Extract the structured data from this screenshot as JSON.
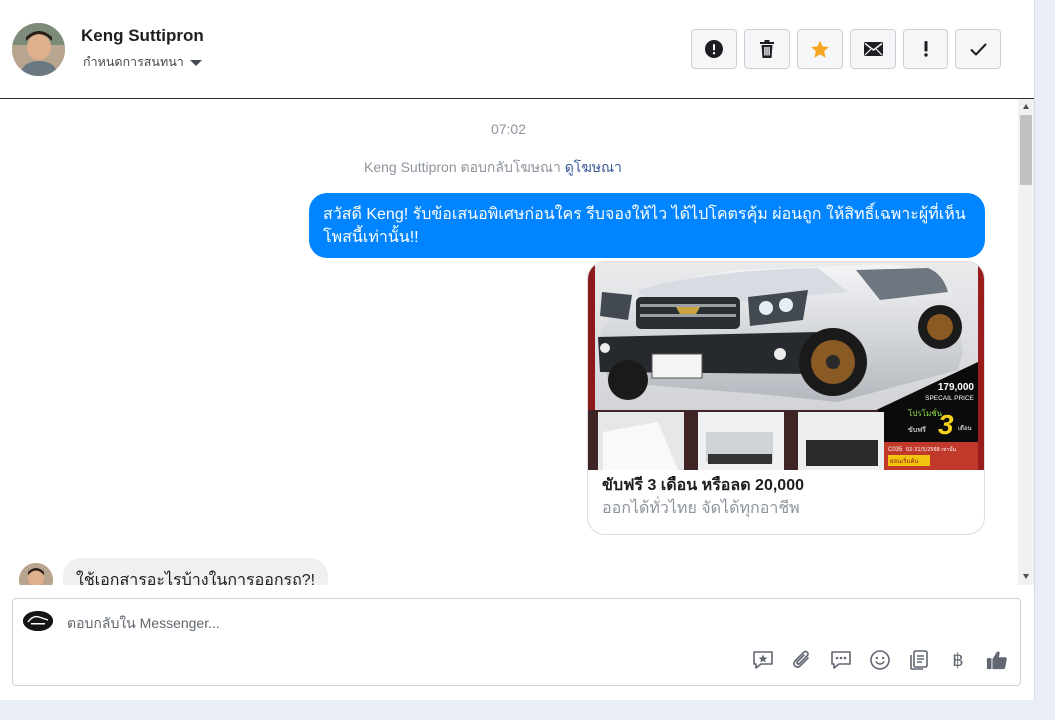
{
  "header": {
    "contact_name": "Keng Suttipron",
    "assign_label": "กำหนดการสนทนา",
    "actions": [
      {
        "icon": "exclamation-circle-icon",
        "label": "Mark as spam"
      },
      {
        "icon": "trash-icon",
        "label": "Delete"
      },
      {
        "icon": "star-icon",
        "label": "Star",
        "color": "#f5a623"
      },
      {
        "icon": "envelope-icon",
        "label": "Mark as unread"
      },
      {
        "icon": "exclamation-icon",
        "label": "Follow up"
      },
      {
        "icon": "check-icon",
        "label": "Mark as done"
      }
    ]
  },
  "messages": {
    "timestamp": "07:02",
    "ad_reply_note": "Keng Suttipron ตอบกลับโฆษณา",
    "view_ad_link": "ดูโฆษณา",
    "outgoing_text": "สวัสดี Keng! รับข้อเสนอพิเศษก่อนใคร รีบจองให้ไว ได้ไปโคตรคุ้ม ผ่อนถูก ให้สิทธิ์เฉพาะผู้ที่เห็นโพสนี้เท่านั้น!!",
    "ad_card": {
      "title": "ขับฟรี 3 เดือน หรือลด 20,000",
      "subtitle": "ออกได้ทั่วไทย จัดได้ทุกอาชีพ",
      "image_price": "179,000",
      "image_price_label": "SPECAIL PRICE",
      "image_promo_label": "โปรโมชั่น",
      "image_promo_number": "3",
      "image_promo_unit": "เดือน",
      "image_free_label": "ขับฟรี",
      "image_code": "C035",
      "image_date": "02-31/5/2568 เท่านั้น",
      "image_down_label": "ผ่อนเริ่มต้น"
    },
    "incoming_text": "ใช้เอกสารอะไรบ้างในการออกรถ?!"
  },
  "composer": {
    "placeholder": "ตอบกลับใน Messenger...",
    "tools": [
      {
        "icon": "saved-reply-icon"
      },
      {
        "icon": "paperclip-icon"
      },
      {
        "icon": "chat-bubble-icon"
      },
      {
        "icon": "emoji-icon"
      },
      {
        "icon": "notes-icon"
      },
      {
        "icon": "baht-icon",
        "glyph": "฿"
      },
      {
        "icon": "thumbs-up-icon"
      }
    ]
  },
  "colors": {
    "messenger_blue": "#0084ff",
    "star_orange": "#f5a623",
    "link_blue": "#385898"
  }
}
